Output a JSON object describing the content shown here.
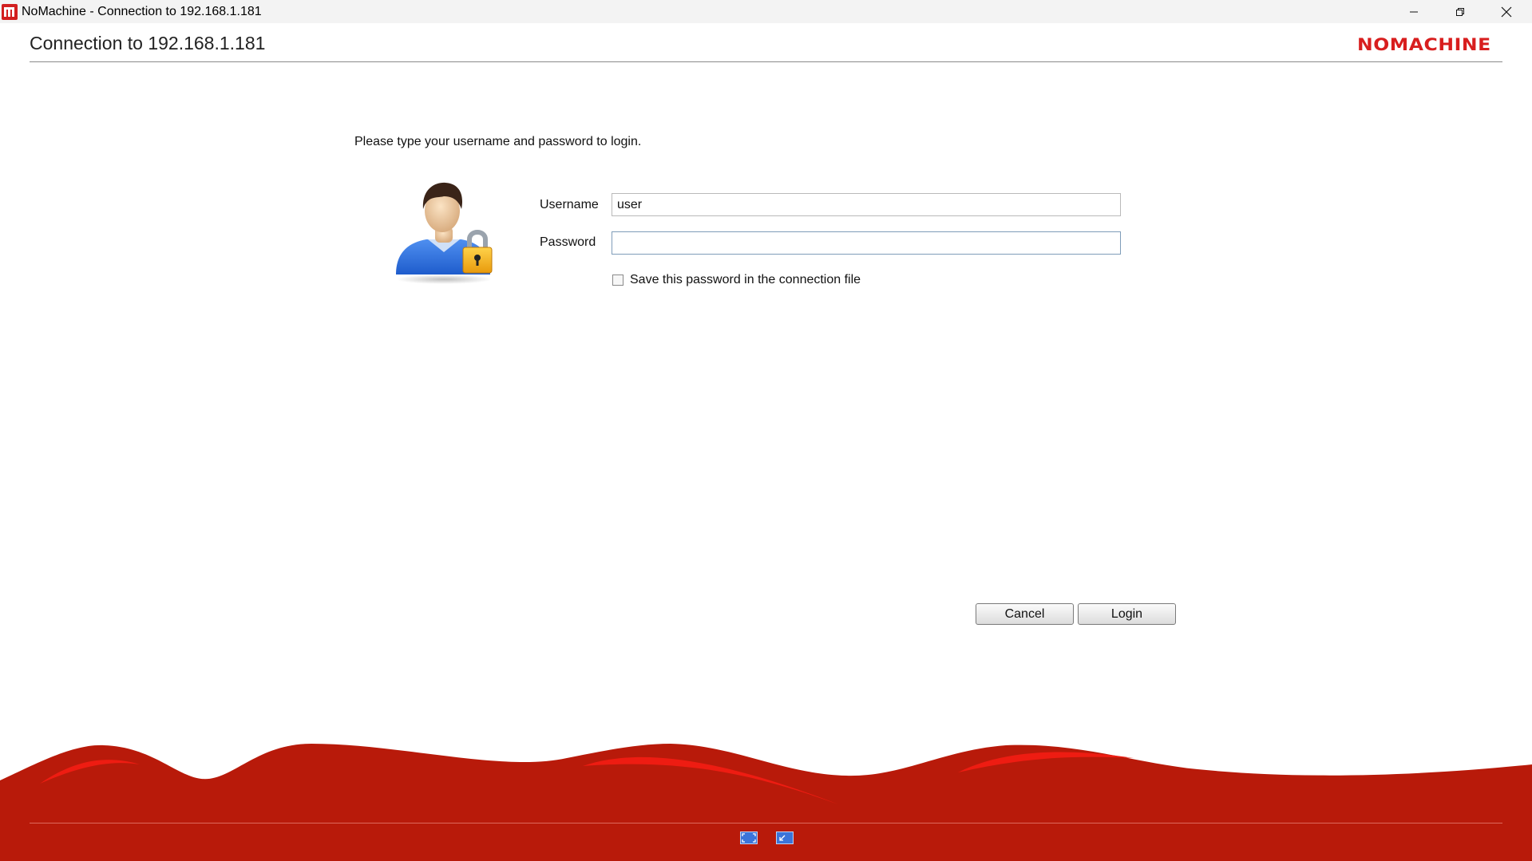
{
  "window": {
    "title": "NoMachine - Connection to 192.168.1.181"
  },
  "header": {
    "title": "Connection to 192.168.1.181",
    "logo": "NOMACHINE"
  },
  "form": {
    "instructions": "Please type your username and password to login.",
    "username_label": "Username",
    "username_value": "user",
    "password_label": "Password",
    "password_value": "",
    "save_password_label": "Save this password in the connection file",
    "save_password_checked": false
  },
  "buttons": {
    "cancel": "Cancel",
    "login": "Login"
  },
  "footer": {
    "icons": [
      "fullscreen-icon",
      "resize-window-icon"
    ]
  },
  "colors": {
    "brand_red": "#d81e1e",
    "footer_red": "#b81a0a"
  }
}
